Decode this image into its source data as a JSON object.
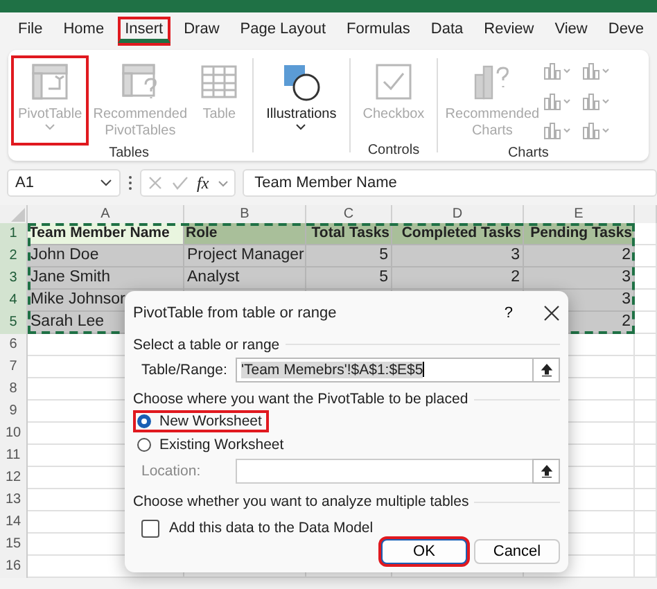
{
  "ribbon_tabs": [
    {
      "label": "File",
      "selected": false,
      "highlighted": false
    },
    {
      "label": "Home",
      "selected": false,
      "highlighted": false
    },
    {
      "label": "Insert",
      "selected": true,
      "highlighted": true
    },
    {
      "label": "Draw",
      "selected": false,
      "highlighted": false
    },
    {
      "label": "Page Layout",
      "selected": false,
      "highlighted": false
    },
    {
      "label": "Formulas",
      "selected": false,
      "highlighted": false
    },
    {
      "label": "Data",
      "selected": false,
      "highlighted": false
    },
    {
      "label": "Review",
      "selected": false,
      "highlighted": false
    },
    {
      "label": "View",
      "selected": false,
      "highlighted": false
    },
    {
      "label": "Deve",
      "selected": false,
      "highlighted": false
    }
  ],
  "ribbon_groups": [
    {
      "label": "Tables",
      "buttons": [
        {
          "kind": "pivottable",
          "label": "PivotTable",
          "disabled": true,
          "highlighted": true,
          "dropdown": true
        },
        {
          "kind": "recommended_pivot",
          "label": "Recommended PivotTables",
          "disabled": true,
          "highlighted": false,
          "dropdown": false
        },
        {
          "kind": "table",
          "label": "Table",
          "disabled": true,
          "highlighted": false,
          "dropdown": false
        }
      ]
    },
    {
      "buttons": [
        {
          "kind": "shapes",
          "label": "Illustrations",
          "disabled": false,
          "highlighted": false,
          "dropdown": true
        }
      ]
    },
    {
      "label": "Controls",
      "buttons": [
        {
          "kind": "checkbox",
          "label": "Checkbox",
          "disabled": true,
          "highlighted": false,
          "dropdown": false
        }
      ]
    },
    {
      "label": "Charts",
      "buttons": [
        {
          "kind": "recommended_charts",
          "label": "Recommended Charts",
          "disabled": true,
          "highlighted": false,
          "dropdown": false
        },
        {
          "kind": "gallery",
          "disabled": true
        }
      ]
    }
  ],
  "formula_bar": {
    "name_box": "A1",
    "function_label": "fx",
    "formula": "Team Member Name"
  },
  "sheet": {
    "columns": [
      "A",
      "B",
      "C",
      "D",
      "E"
    ],
    "copy_marquee": true,
    "rows": [
      {
        "number": "1",
        "selected": true,
        "cells": [
          {
            "text": "Team Member Name",
            "active": true
          },
          {
            "text": "Role",
            "active": false
          },
          {
            "text": "Total Tasks",
            "active": false
          },
          {
            "text": "Completed Tasks",
            "active": false
          },
          {
            "text": "Pending Tasks",
            "active": false
          }
        ]
      },
      {
        "number": "2",
        "selected": true,
        "cells": [
          {
            "text": "John Doe",
            "active": false
          },
          {
            "text": "Project Manager",
            "active": false
          },
          {
            "text": "5",
            "active": false
          },
          {
            "text": "3",
            "active": false
          },
          {
            "text": "2",
            "active": false
          }
        ]
      },
      {
        "number": "3",
        "selected": true,
        "cells": [
          {
            "text": "Jane Smith",
            "active": false
          },
          {
            "text": "Analyst",
            "active": false
          },
          {
            "text": "5",
            "active": false
          },
          {
            "text": "2",
            "active": false
          },
          {
            "text": "3",
            "active": false
          }
        ]
      },
      {
        "number": "4",
        "selected": true,
        "cells": [
          {
            "text": "Mike Johnsor",
            "active": false
          },
          null,
          null,
          null,
          {
            "text": "3",
            "active": false
          }
        ]
      },
      {
        "number": "5",
        "selected": true,
        "cells": [
          {
            "text": "Sarah Lee",
            "active": false
          },
          null,
          null,
          null,
          {
            "text": "2",
            "active": false
          }
        ]
      },
      {
        "number": "6",
        "selected": false,
        "cells": []
      },
      {
        "number": "7",
        "selected": false,
        "cells": []
      },
      {
        "number": "8",
        "selected": false,
        "cells": []
      },
      {
        "number": "9",
        "selected": false,
        "cells": []
      },
      {
        "number": "10",
        "selected": false,
        "cells": []
      },
      {
        "number": "11",
        "selected": false,
        "cells": []
      },
      {
        "number": "12",
        "selected": false,
        "cells": []
      },
      {
        "number": "13",
        "selected": false,
        "cells": []
      },
      {
        "number": "14",
        "selected": false,
        "cells": []
      },
      {
        "number": "15",
        "selected": false,
        "cells": []
      },
      {
        "number": "16",
        "selected": false,
        "cells": []
      }
    ]
  },
  "dialog": {
    "title": "PivotTable from table or range",
    "help": "?",
    "section_1": "Select a table or range",
    "range": {
      "label": "Table/Range:",
      "value": "'Team Memebrs'!$A$1:$E$5",
      "value_selected": true
    },
    "section_2": "Choose where you want the PivotTable to be placed",
    "placement_options": [
      {
        "label": "New Worksheet",
        "selected": true,
        "highlighted": true
      },
      {
        "label": "Existing Worksheet",
        "selected": false,
        "highlighted": false
      }
    ],
    "location": {
      "label": "Location:",
      "disabled": true
    },
    "section_3": "Choose whether you want to analyze multiple tables",
    "data_model": {
      "label": "Add this data to the Data Model",
      "checked": false
    },
    "buttons": [
      {
        "label": "OK",
        "default": true,
        "highlighted": true
      },
      {
        "label": "Cancel",
        "default": false,
        "highlighted": false
      }
    ]
  }
}
